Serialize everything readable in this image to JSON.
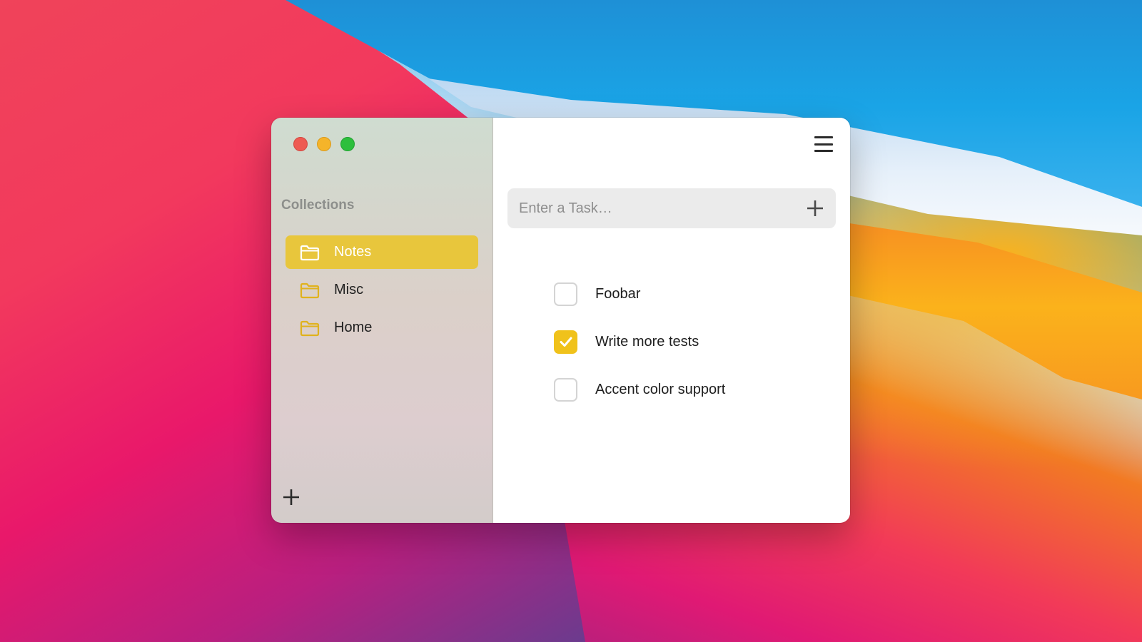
{
  "sidebar": {
    "section_title": "Collections",
    "collections": [
      {
        "label": "Notes",
        "active": true
      },
      {
        "label": "Misc",
        "active": false
      },
      {
        "label": "Home",
        "active": false
      }
    ],
    "add_icon": "plus-icon"
  },
  "main": {
    "menu_icon": "hamburger-menu-icon",
    "task_input": {
      "placeholder": "Enter a Task…",
      "value": ""
    },
    "add_task_icon": "plus-icon",
    "tasks": [
      {
        "label": "Foobar",
        "done": false
      },
      {
        "label": "Write more tests",
        "done": true
      },
      {
        "label": "Accent color support",
        "done": false
      }
    ]
  },
  "colors": {
    "accent": "#e8c63c",
    "check_accent": "#f0c21b",
    "traffic_red": "#ee5a52",
    "traffic_yellow": "#f5b42a",
    "traffic_green": "#2dbf3d"
  }
}
